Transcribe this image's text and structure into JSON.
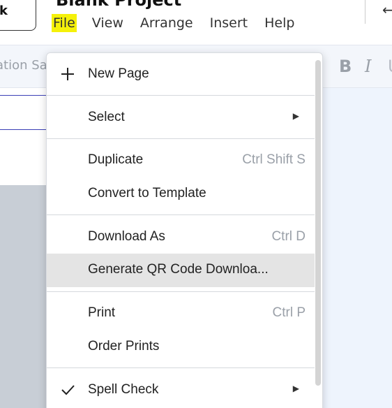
{
  "header": {
    "back_label": "k",
    "project_title": "Blank Project",
    "menus": [
      "File",
      "View",
      "Arrange",
      "Insert",
      "Help"
    ],
    "right_icon": "arrow-left-icon"
  },
  "toolbar": {
    "font_value": "ation Sa",
    "bold_label": "B",
    "italic_label": "I",
    "underline_label": "U"
  },
  "file_menu": {
    "new_page": {
      "label": "New Page",
      "icon": "plus-icon"
    },
    "select": {
      "label": "Select"
    },
    "duplicate": {
      "label": "Duplicate",
      "shortcut": "Ctrl Shift S"
    },
    "convert": {
      "label": "Convert to Template"
    },
    "download": {
      "label": "Download As",
      "shortcut": "Ctrl D"
    },
    "qr": {
      "label": "Generate QR Code Downloa..."
    },
    "print": {
      "label": "Print",
      "shortcut": "Ctrl P"
    },
    "order_prints": {
      "label": "Order Prints"
    },
    "spell_check": {
      "label": "Spell Check",
      "icon": "checkmark-icon"
    }
  },
  "colors": {
    "active_menu_highlight": "#f5f10a",
    "hover_row": "#e4e4e4",
    "toolbar_bg": "#f3f6fb",
    "canvas_bg": "#eef4fd"
  }
}
